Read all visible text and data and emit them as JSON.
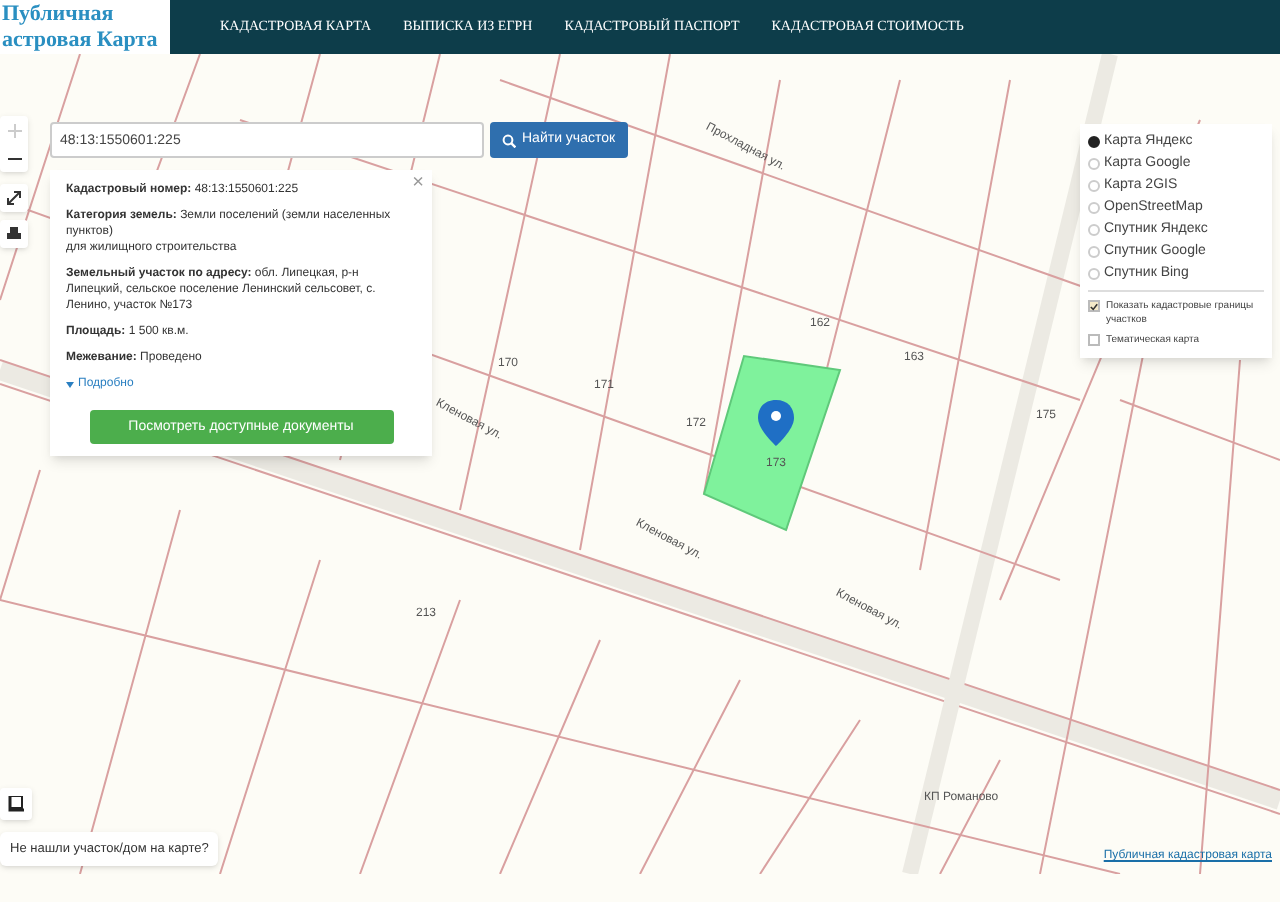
{
  "logo": {
    "line_1": "Публичная",
    "line_2": "астровая Карта"
  },
  "nav": [
    {
      "label": "КАДАСТРОВАЯ КАРТА"
    },
    {
      "label": "ВЫПИСКА ИЗ ЕГРН"
    },
    {
      "label": "КАДАСТРОВЫЙ ПАСПОРТ"
    },
    {
      "label": "КАДАСТРОВАЯ СТОИМОСТЬ"
    }
  ],
  "search": {
    "value": "48:13:1550601:225",
    "button": "Найти участок"
  },
  "popup": {
    "close": "×",
    "fields": [
      {
        "label": "Кадастровый номер:",
        "value": "48:13:1550601:225"
      },
      {
        "label": "Категория земель:",
        "value": "Земли поселений (земли населенных пунктов)",
        "extra": "для жилищного строительства"
      },
      {
        "label": "Земельный участок по адресу:",
        "value": "обл. Липецкая, р-н Липецкий, сельское поселение Ленинский сельсовет, с. Ленино, участок №173"
      },
      {
        "label": "Площадь:",
        "value": "1 500 кв.м."
      },
      {
        "label": "Межевание:",
        "value": "Проведено"
      }
    ],
    "more": "Подробно",
    "more_expanded": false,
    "button": "Посмотреть доступные документы"
  },
  "layers": [
    {
      "label": "Карта Яндекс",
      "selected": true
    },
    {
      "label": "Карта Google",
      "selected": false
    },
    {
      "label": "Карта 2GIS",
      "selected": false
    },
    {
      "label": "OpenStreetMap",
      "selected": false
    },
    {
      "label": "Спутник Яндекс",
      "selected": false
    },
    {
      "label": "Спутник Google",
      "selected": false
    },
    {
      "label": "Спутник Bing",
      "selected": false
    }
  ],
  "overlays": [
    {
      "label": "Показать кадастровые границы участков",
      "checked": true
    },
    {
      "label": "Тематическая карта",
      "checked": false
    }
  ],
  "map_labels": [
    {
      "text": "Кленовая ул."
    },
    {
      "text": "Кленовая ул."
    },
    {
      "text": "Кленовая ул."
    },
    {
      "text": "Прохладная ул."
    },
    {
      "text": "КП Романово"
    },
    {
      "text": "162"
    },
    {
      "text": "163"
    },
    {
      "text": "171"
    },
    {
      "text": "172"
    },
    {
      "text": "170"
    },
    {
      "text": "173"
    },
    {
      "text": "175"
    },
    {
      "text": "213"
    }
  ],
  "not_found": "Не нашли участок/дом на карте?",
  "attribution": "Публичная кадастровая карта"
}
